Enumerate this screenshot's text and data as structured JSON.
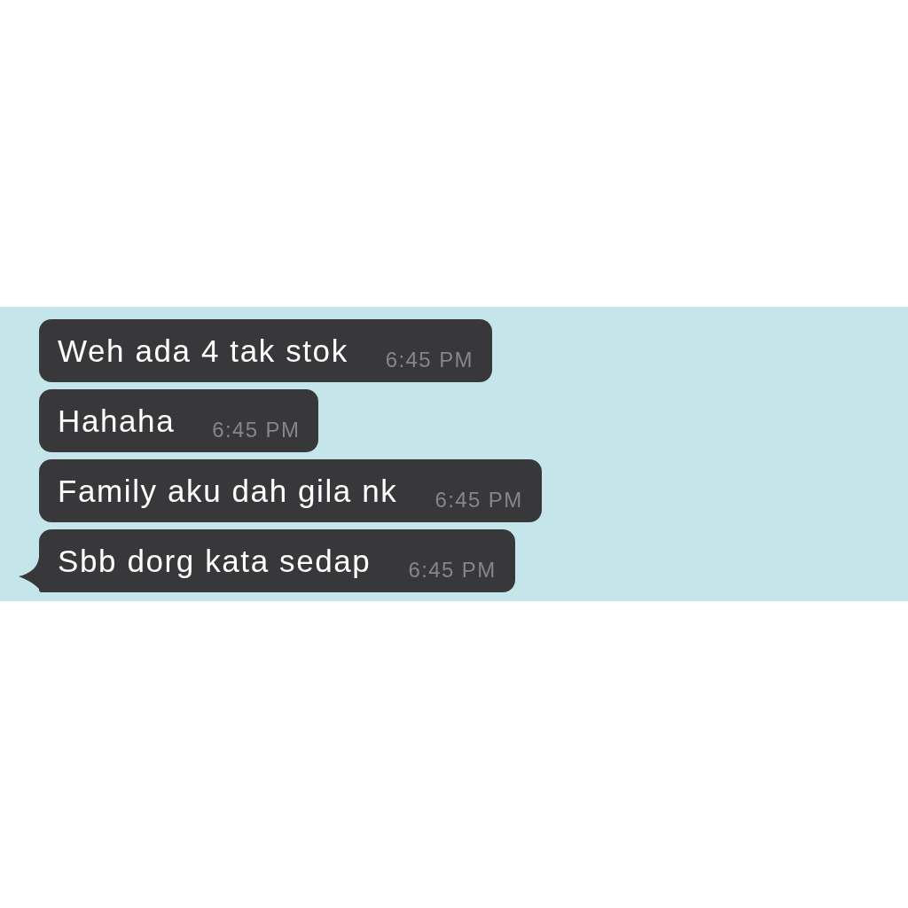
{
  "messages": [
    {
      "text": "Weh ada 4 tak stok",
      "time": "6:45 PM",
      "tail": false
    },
    {
      "text": "Hahaha",
      "time": "6:45 PM",
      "tail": false
    },
    {
      "text": "Family aku dah gila nk",
      "time": "6:45 PM",
      "tail": false
    },
    {
      "text": "Sbb dorg kata sedap",
      "time": "6:45 PM",
      "tail": true
    }
  ]
}
